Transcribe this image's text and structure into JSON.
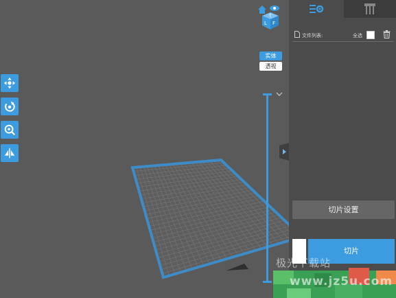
{
  "toolbar": {
    "items": [
      {
        "name": "move",
        "icon": "move-arrows-icon"
      },
      {
        "name": "rotate",
        "icon": "rotate-icon"
      },
      {
        "name": "scale",
        "icon": "scale-icon"
      },
      {
        "name": "mirror",
        "icon": "mirror-icon"
      }
    ]
  },
  "viewcube": {
    "home_icon": "home-icon",
    "eye_icon": "eye-icon",
    "faces": [
      "T",
      "L",
      "F"
    ]
  },
  "view_mode": {
    "solid_label": "实体",
    "perspective_label": "透视",
    "active": "solid"
  },
  "panel": {
    "tabs": [
      {
        "name": "model-settings",
        "icon": "list-gear-icon",
        "active": true
      },
      {
        "name": "support",
        "icon": "support-icon",
        "active": false
      }
    ],
    "file_list_label": "文件列表:",
    "select_all_label": "全选",
    "select_all_checked": false,
    "slice_settings_label": "切片设置",
    "slice_label": "切片"
  },
  "watermark": {
    "text": "极光下载站",
    "url": "www.jz5u.com"
  },
  "colors": {
    "accent": "#3d9be0",
    "viewport_bg": "#5a5a5a",
    "panel_bg": "#4b4b4b",
    "plate_grid": "#767676"
  }
}
